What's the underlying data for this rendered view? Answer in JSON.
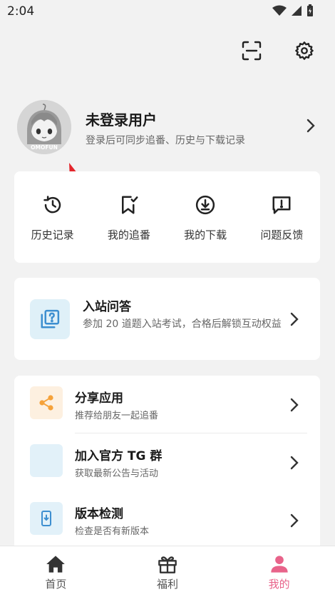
{
  "status": {
    "time": "2:04"
  },
  "top_actions": {
    "scan_icon": "scan-icon",
    "settings_icon": "gear-icon"
  },
  "profile": {
    "avatar_text": "OMOFUN",
    "name": "未登录用户",
    "subtitle": "登录后可同步追番、历史与下载记录"
  },
  "quick_actions": [
    {
      "label": "历史记录",
      "icon": "history-icon"
    },
    {
      "label": "我的追番",
      "icon": "bookmark-icon"
    },
    {
      "label": "我的下载",
      "icon": "download-icon"
    },
    {
      "label": "问题反馈",
      "icon": "feedback-icon"
    }
  ],
  "entry": {
    "title": "入站问答",
    "desc": "参加 20 道题入站考试，合格后解锁互动权益"
  },
  "list": [
    {
      "title": "分享应用",
      "subtitle": "推荐给朋友一起追番",
      "icon": "share-icon"
    },
    {
      "title": "加入官方 TG 群",
      "subtitle": "获取最新公告与活动",
      "icon": "telegram-icon"
    },
    {
      "title": "版本检测",
      "subtitle": "检查是否有新版本",
      "icon": "phone-update-icon"
    }
  ],
  "tabs": [
    {
      "label": "首页",
      "icon": "home-icon",
      "active": false
    },
    {
      "label": "福利",
      "icon": "gift-icon",
      "active": false
    },
    {
      "label": "我的",
      "icon": "user-icon",
      "active": true
    }
  ],
  "colors": {
    "accent": "#e8638a",
    "background": "#f2f2f2",
    "share_orange": "#f5a23a",
    "blue": "#3d8fd0"
  }
}
